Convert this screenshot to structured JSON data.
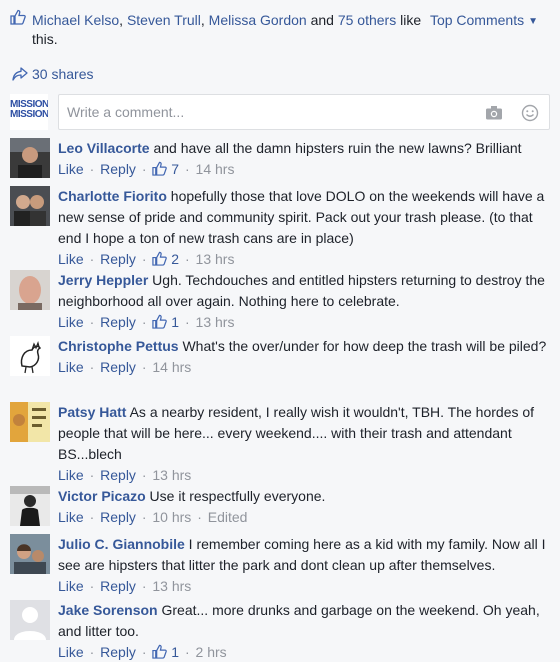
{
  "likes": {
    "names": [
      "Michael Kelso",
      "Steven Trull",
      "Melissa Gordon"
    ],
    "sep1": ", ",
    "sep2": ", ",
    "and_text": " and ",
    "others": "75 others",
    "suffix": " like this."
  },
  "sort_label": "Top Comments",
  "shares_label": "30 shares",
  "compose": {
    "avatar_text": [
      "MISSION",
      "MISSION"
    ],
    "placeholder": "Write a comment..."
  },
  "action_labels": {
    "like": "Like",
    "reply": "Reply",
    "dot": " · "
  },
  "comments": [
    {
      "author": "Leo Villacorte",
      "text": " and have all the damn hipsters ruin the new lawns? Brilliant",
      "likes": "7",
      "time": "14 hrs",
      "edited": ""
    },
    {
      "author": "Charlotte Fiorito",
      "text": " hopefully those that love DOLO on the weekends will have a new sense of pride and community spirit. Pack out your trash please. (to that end I hope a ton of new trash cans are in place)",
      "likes": "2",
      "time": "13 hrs",
      "edited": ""
    },
    {
      "author": "Jerry Heppler",
      "text": " Ugh. Techdouches and entitled hipsters returning to destroy the neighborhood all over again. Nothing here to celebrate.",
      "likes": "1",
      "time": "13 hrs",
      "edited": ""
    },
    {
      "author": "Christophe Pettus",
      "text": " What's the over/under for how deep the trash will be piled?",
      "likes": "",
      "time": "14 hrs",
      "edited": ""
    },
    {
      "author": "Patsy Hatt",
      "text": " As a nearby resident, I really wish it wouldn't, TBH. The hordes of people that will be here... every weekend.... with their trash and attendant BS...blech",
      "likes": "",
      "time": "13 hrs",
      "edited": ""
    },
    {
      "author": "Victor Picazo",
      "text": " Use it respectfully everyone.",
      "likes": "",
      "time": "10 hrs",
      "edited": "Edited"
    },
    {
      "author": "Julio C. Giannobile",
      "text": " I remember coming here as a kid with my family. Now all I see are hipsters that litter the park and dont clean up after themselves.",
      "likes": "",
      "time": "13 hrs",
      "edited": ""
    },
    {
      "author": "Jake Sorenson",
      "text": " Great... more drunks and garbage on the weekend. Oh yeah, and litter too.",
      "likes": "1",
      "time": "2 hrs",
      "edited": ""
    }
  ],
  "colors": {
    "link": "#365899",
    "meta": "#90949c",
    "background": "#f6f7f9"
  }
}
